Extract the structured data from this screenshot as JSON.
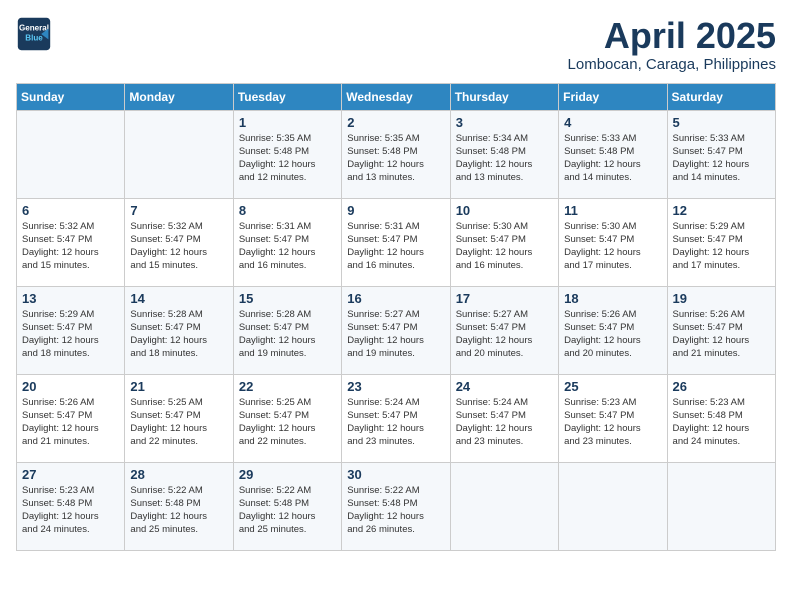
{
  "header": {
    "logo_line1": "General",
    "logo_line2": "Blue",
    "title": "April 2025",
    "subtitle": "Lombocan, Caraga, Philippines"
  },
  "calendar": {
    "weekdays": [
      "Sunday",
      "Monday",
      "Tuesday",
      "Wednesday",
      "Thursday",
      "Friday",
      "Saturday"
    ],
    "weeks": [
      [
        {
          "day": "",
          "detail": ""
        },
        {
          "day": "",
          "detail": ""
        },
        {
          "day": "1",
          "detail": "Sunrise: 5:35 AM\nSunset: 5:48 PM\nDaylight: 12 hours\nand 12 minutes."
        },
        {
          "day": "2",
          "detail": "Sunrise: 5:35 AM\nSunset: 5:48 PM\nDaylight: 12 hours\nand 13 minutes."
        },
        {
          "day": "3",
          "detail": "Sunrise: 5:34 AM\nSunset: 5:48 PM\nDaylight: 12 hours\nand 13 minutes."
        },
        {
          "day": "4",
          "detail": "Sunrise: 5:33 AM\nSunset: 5:48 PM\nDaylight: 12 hours\nand 14 minutes."
        },
        {
          "day": "5",
          "detail": "Sunrise: 5:33 AM\nSunset: 5:47 PM\nDaylight: 12 hours\nand 14 minutes."
        }
      ],
      [
        {
          "day": "6",
          "detail": "Sunrise: 5:32 AM\nSunset: 5:47 PM\nDaylight: 12 hours\nand 15 minutes."
        },
        {
          "day": "7",
          "detail": "Sunrise: 5:32 AM\nSunset: 5:47 PM\nDaylight: 12 hours\nand 15 minutes."
        },
        {
          "day": "8",
          "detail": "Sunrise: 5:31 AM\nSunset: 5:47 PM\nDaylight: 12 hours\nand 16 minutes."
        },
        {
          "day": "9",
          "detail": "Sunrise: 5:31 AM\nSunset: 5:47 PM\nDaylight: 12 hours\nand 16 minutes."
        },
        {
          "day": "10",
          "detail": "Sunrise: 5:30 AM\nSunset: 5:47 PM\nDaylight: 12 hours\nand 16 minutes."
        },
        {
          "day": "11",
          "detail": "Sunrise: 5:30 AM\nSunset: 5:47 PM\nDaylight: 12 hours\nand 17 minutes."
        },
        {
          "day": "12",
          "detail": "Sunrise: 5:29 AM\nSunset: 5:47 PM\nDaylight: 12 hours\nand 17 minutes."
        }
      ],
      [
        {
          "day": "13",
          "detail": "Sunrise: 5:29 AM\nSunset: 5:47 PM\nDaylight: 12 hours\nand 18 minutes."
        },
        {
          "day": "14",
          "detail": "Sunrise: 5:28 AM\nSunset: 5:47 PM\nDaylight: 12 hours\nand 18 minutes."
        },
        {
          "day": "15",
          "detail": "Sunrise: 5:28 AM\nSunset: 5:47 PM\nDaylight: 12 hours\nand 19 minutes."
        },
        {
          "day": "16",
          "detail": "Sunrise: 5:27 AM\nSunset: 5:47 PM\nDaylight: 12 hours\nand 19 minutes."
        },
        {
          "day": "17",
          "detail": "Sunrise: 5:27 AM\nSunset: 5:47 PM\nDaylight: 12 hours\nand 20 minutes."
        },
        {
          "day": "18",
          "detail": "Sunrise: 5:26 AM\nSunset: 5:47 PM\nDaylight: 12 hours\nand 20 minutes."
        },
        {
          "day": "19",
          "detail": "Sunrise: 5:26 AM\nSunset: 5:47 PM\nDaylight: 12 hours\nand 21 minutes."
        }
      ],
      [
        {
          "day": "20",
          "detail": "Sunrise: 5:26 AM\nSunset: 5:47 PM\nDaylight: 12 hours\nand 21 minutes."
        },
        {
          "day": "21",
          "detail": "Sunrise: 5:25 AM\nSunset: 5:47 PM\nDaylight: 12 hours\nand 22 minutes."
        },
        {
          "day": "22",
          "detail": "Sunrise: 5:25 AM\nSunset: 5:47 PM\nDaylight: 12 hours\nand 22 minutes."
        },
        {
          "day": "23",
          "detail": "Sunrise: 5:24 AM\nSunset: 5:47 PM\nDaylight: 12 hours\nand 23 minutes."
        },
        {
          "day": "24",
          "detail": "Sunrise: 5:24 AM\nSunset: 5:47 PM\nDaylight: 12 hours\nand 23 minutes."
        },
        {
          "day": "25",
          "detail": "Sunrise: 5:23 AM\nSunset: 5:47 PM\nDaylight: 12 hours\nand 23 minutes."
        },
        {
          "day": "26",
          "detail": "Sunrise: 5:23 AM\nSunset: 5:48 PM\nDaylight: 12 hours\nand 24 minutes."
        }
      ],
      [
        {
          "day": "27",
          "detail": "Sunrise: 5:23 AM\nSunset: 5:48 PM\nDaylight: 12 hours\nand 24 minutes."
        },
        {
          "day": "28",
          "detail": "Sunrise: 5:22 AM\nSunset: 5:48 PM\nDaylight: 12 hours\nand 25 minutes."
        },
        {
          "day": "29",
          "detail": "Sunrise: 5:22 AM\nSunset: 5:48 PM\nDaylight: 12 hours\nand 25 minutes."
        },
        {
          "day": "30",
          "detail": "Sunrise: 5:22 AM\nSunset: 5:48 PM\nDaylight: 12 hours\nand 26 minutes."
        },
        {
          "day": "",
          "detail": ""
        },
        {
          "day": "",
          "detail": ""
        },
        {
          "day": "",
          "detail": ""
        }
      ]
    ]
  }
}
